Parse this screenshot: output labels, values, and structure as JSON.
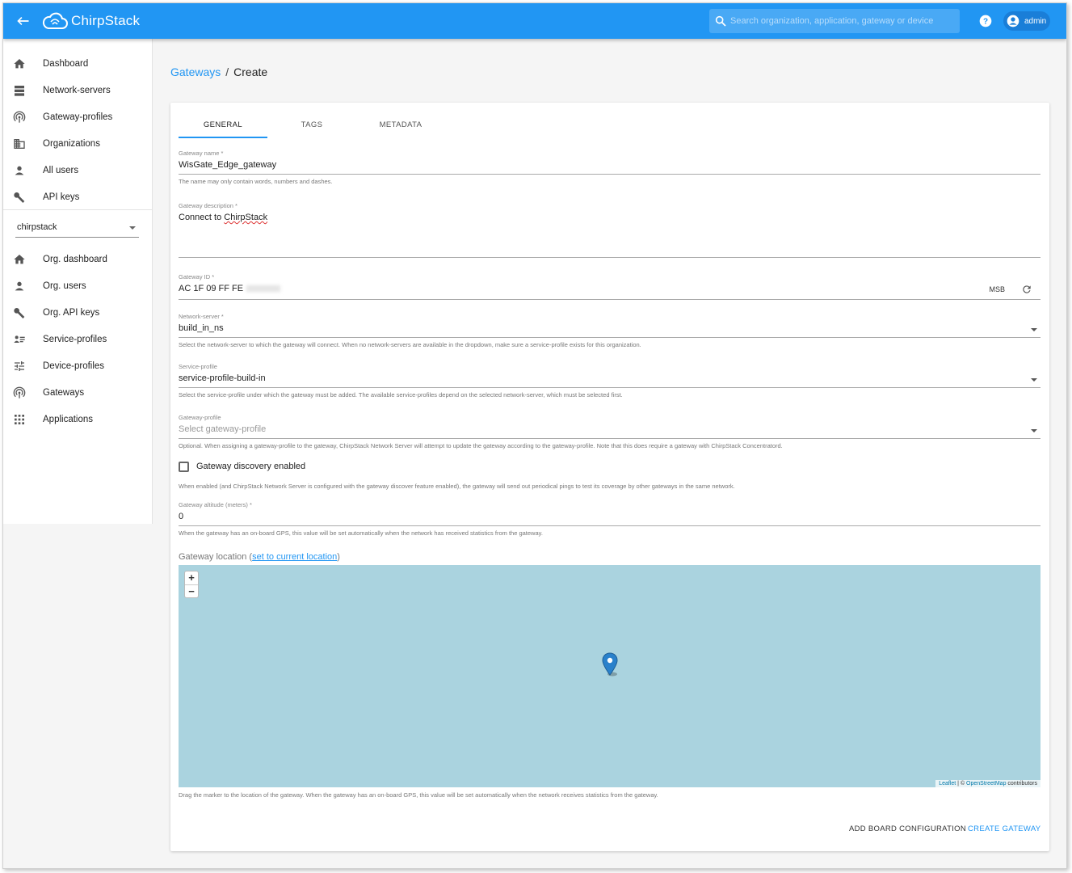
{
  "app": {
    "name": "ChirpStack",
    "search_placeholder": "Search organization, application, gateway or device",
    "user": "admin"
  },
  "sidebar": {
    "admin_items": [
      {
        "label": "Dashboard",
        "icon": "home-icon"
      },
      {
        "label": "Network-servers",
        "icon": "server-icon"
      },
      {
        "label": "Gateway-profiles",
        "icon": "radio-tower-icon"
      },
      {
        "label": "Organizations",
        "icon": "domain-icon"
      },
      {
        "label": "All users",
        "icon": "user-icon"
      },
      {
        "label": "API keys",
        "icon": "key-icon"
      }
    ],
    "org_select": "chirpstack",
    "org_items": [
      {
        "label": "Org. dashboard",
        "icon": "home-icon"
      },
      {
        "label": "Org. users",
        "icon": "user-icon"
      },
      {
        "label": "Org. API keys",
        "icon": "key-icon"
      },
      {
        "label": "Service-profiles",
        "icon": "account-details-icon"
      },
      {
        "label": "Device-profiles",
        "icon": "tune-icon"
      },
      {
        "label": "Gateways",
        "icon": "radio-tower-icon"
      },
      {
        "label": "Applications",
        "icon": "apps-icon"
      }
    ]
  },
  "breadcrumb": {
    "parent": "Gateways",
    "separator": "/",
    "current": "Create"
  },
  "tabs": [
    "GENERAL",
    "TAGS",
    "METADATA"
  ],
  "form": {
    "name": {
      "label": "Gateway name *",
      "value": "WisGate_Edge_gateway",
      "help": "The name may only contain words, numbers and dashes."
    },
    "description": {
      "label": "Gateway description *",
      "value_prefix": "Connect to ",
      "value_word": "ChirpStack"
    },
    "gateway_id": {
      "label": "Gateway ID *",
      "value": "AC 1F 09 FF FE",
      "byte_order": "MSB"
    },
    "network_server": {
      "label": "Network-server *",
      "value": "build_in_ns",
      "help": "Select the network-server to which the gateway will connect. When no network-servers are available in the dropdown, make sure a service-profile exists for this organization."
    },
    "service_profile": {
      "label": "Service-profile",
      "value": "service-profile-build-in",
      "help": "Select the service-profile under which the gateway must be added. The available service-profiles depend on the selected network-server, which must be selected first."
    },
    "gateway_profile": {
      "label": "Gateway-profile",
      "placeholder": "Select gateway-profile",
      "help": "Optional. When assigning a gateway-profile to the gateway, ChirpStack Network Server will attempt to update the gateway according to the gateway-profile. Note that this does require a gateway with ChirpStack Concentratord."
    },
    "discovery": {
      "label": "Gateway discovery enabled",
      "checked": false,
      "help": "When enabled (and ChirpStack Network Server is configured with the gateway discover feature enabled), the gateway will send out periodical pings to test its coverage by other gateways in the same network."
    },
    "altitude": {
      "label": "Gateway altitude (meters) *",
      "value": "0",
      "help": "When the gateway has an on-board GPS, this value will be set automatically when the network has received statistics from the gateway."
    },
    "location": {
      "label": "Gateway location (",
      "link": "set to current location",
      "suffix": ")",
      "help": "Drag the marker to the location of the gateway. When the gateway has an on-board GPS, this value will be set automatically when the network receives statistics from the gateway."
    }
  },
  "map": {
    "zoom_in": "+",
    "zoom_out": "−",
    "attrib_leaflet": "Leaflet",
    "attrib_sep": " | © ",
    "attrib_osm": "OpenStreetMap",
    "attrib_suffix": " contributors",
    "water_color": "#aad3df",
    "marker_color": "#2a81cb"
  },
  "actions": {
    "board": "ADD BOARD CONFIGURATION",
    "create": "CREATE GATEWAY"
  }
}
